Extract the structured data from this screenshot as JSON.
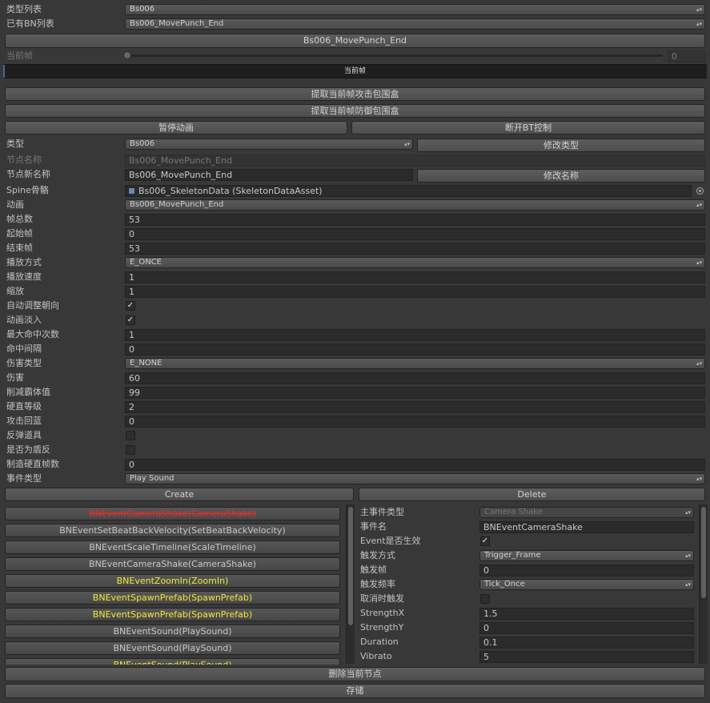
{
  "top": {
    "type_list_label": "类型列表",
    "type_list_value": "Bs006",
    "bn_list_label": "已有BN列表",
    "bn_list_value": "Bs006_MovePunch_End",
    "node_button": "Bs006_MovePunch_End",
    "frame_label": "当前帧",
    "frame_value": "0",
    "frame_fraction": 0,
    "frame_bar_label": "当前帧"
  },
  "actions": {
    "extract_attack": "提取当前帧攻击包围盒",
    "extract_defense": "提取当前帧防御包围盒",
    "pause_anim": "暂停动画",
    "disconnect_bt": "断开BT控制"
  },
  "props": {
    "type_label": "类型",
    "type_value": "Bs006",
    "modify_type": "修改类型",
    "node_name_label": "节点名称",
    "node_name_value": "Bs006_MovePunch_End",
    "node_new_name_label": "节点新名称",
    "node_new_name_value": "Bs006_MovePunch_End",
    "modify_name": "修改名称",
    "spine_label": "Spine骨骼",
    "spine_value": "Bs006_SkeletonData (SkeletonDataAsset)",
    "anim_label": "动画",
    "anim_value": "Bs006_MovePunch_End",
    "total_frames_label": "帧总数",
    "total_frames_value": "53",
    "start_frame_label": "起始帧",
    "start_frame_value": "0",
    "end_frame_label": "结束帧",
    "end_frame_value": "53",
    "play_mode_label": "播放方式",
    "play_mode_value": "E_ONCE",
    "play_speed_label": "播放速度",
    "play_speed_value": "1",
    "scale_label": "缩放",
    "scale_value": "1",
    "auto_face_label": "自动调整朝向",
    "auto_face_checked": true,
    "fade_label": "动画淡入",
    "fade_checked": true,
    "max_hits_label": "最大命中次数",
    "max_hits_value": "1",
    "hit_interval_label": "命中间隔",
    "hit_interval_value": "0",
    "damage_type_label": "伤害类型",
    "damage_type_value": "E_NONE",
    "damage_label": "伤害",
    "damage_value": "60",
    "reduce_label": "削减霸体值",
    "reduce_value": "99",
    "hard_level_label": "硬直等级",
    "hard_level_value": "2",
    "mana_label": "攻击回蓝",
    "mana_value": "0",
    "reflect_label": "反弹道具",
    "reflect_checked": false,
    "shield_label": "是否为盾反",
    "shield_checked": false,
    "make_hard_label": "制造硬直帧数",
    "make_hard_value": "0",
    "event_type_label": "事件类型",
    "event_type_value": "Play Sound"
  },
  "event_buttons": {
    "create": "Create",
    "delete": "Delete"
  },
  "events": [
    {
      "label": "BNEventCameraShake(CameraShake)",
      "color": "#e8302a",
      "strike": true
    },
    {
      "label": "BNEventSetBeatBackVelocity(SetBeatBackVelocity)",
      "color": "#c8c8c8",
      "strike": false
    },
    {
      "label": "BNEventScaleTimeline(ScaleTimeline)",
      "color": "#c8c8c8",
      "strike": false
    },
    {
      "label": "BNEventCameraShake(CameraShake)",
      "color": "#c8c8c8",
      "strike": false
    },
    {
      "label": "BNEventZoomIn(ZoomIn)",
      "color": "#f2e83a",
      "strike": false
    },
    {
      "label": "BNEventSpawnPrefab(SpawnPrefab)",
      "color": "#f2e83a",
      "strike": false
    },
    {
      "label": "BNEventSpawnPrefab(SpawnPrefab)",
      "color": "#f2e83a",
      "strike": false
    },
    {
      "label": "BNEventSound(PlaySound)",
      "color": "#c8c8c8",
      "strike": false
    },
    {
      "label": "BNEventSound(PlaySound)",
      "color": "#c8c8c8",
      "strike": false
    },
    {
      "label": "BNEventSound(PlaySound)",
      "color": "#f2e83a",
      "strike": false
    }
  ],
  "detail": {
    "main_type_label": "主事件类型",
    "main_type_value": "Camera Shake",
    "event_name_label": "事件名",
    "event_name_value": "BNEventCameraShake",
    "enabled_label": "Event是否生效",
    "enabled_checked": true,
    "trigger_mode_label": "触发方式",
    "trigger_mode_value": "Trigger_Frame",
    "trigger_frame_label": "触发帧",
    "trigger_frame_value": "0",
    "trigger_rate_label": "触发频率",
    "trigger_rate_value": "Tick_Once",
    "cancel_trigger_label": "取消时触发",
    "cancel_trigger_checked": false,
    "strength_x_label": "StrengthX",
    "strength_x_value": "1.5",
    "strength_y_label": "StrengthY",
    "strength_y_value": "0",
    "duration_label": "Duration",
    "duration_value": "0.1",
    "vibrato_label": "Vibrato",
    "vibrato_value": "5"
  },
  "bottom": {
    "delete_node": "删除当前节点",
    "save": "存储"
  },
  "colors": {
    "background": "#383838",
    "field": "#2b2b2b",
    "button": "#555555",
    "event_red": "#e8302a",
    "event_yellow": "#f2e83a",
    "slider_accent": "#3d6a99"
  },
  "icons": {
    "dropdown": "▴▾",
    "check": "✓",
    "asset": "scriptable-object-icon",
    "picker": "object-picker-icon"
  }
}
